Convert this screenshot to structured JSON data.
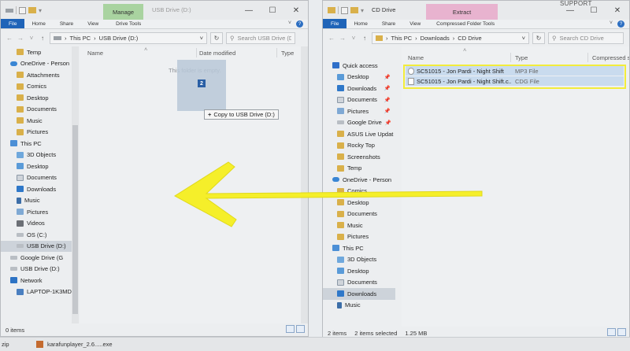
{
  "top_right_label": "SUPPORT",
  "left_window": {
    "context_tab": "Manage",
    "title": "USB Drive (D:)",
    "tabs": [
      "File",
      "Home",
      "Share",
      "View",
      "Drive Tools"
    ],
    "address": [
      "This PC",
      "USB Drive (D:)"
    ],
    "search_placeholder": "Search USB Drive (D:)",
    "columns": [
      "Name",
      "Date modified",
      "Type"
    ],
    "empty_message": "This folder is empty.",
    "nav_items": [
      {
        "label": "Temp",
        "icon": "folder-icon"
      },
      {
        "label": "OneDrive - Person",
        "icon": "onedrive-icon"
      },
      {
        "label": "Attachments",
        "icon": "folder-icon"
      },
      {
        "label": "Comics",
        "icon": "folder-icon"
      },
      {
        "label": "Desktop",
        "icon": "folder-icon"
      },
      {
        "label": "Documents",
        "icon": "folder-icon"
      },
      {
        "label": "Music",
        "icon": "folder-icon"
      },
      {
        "label": "Pictures",
        "icon": "folder-icon"
      },
      {
        "label": "This PC",
        "icon": "this-pc-icon"
      },
      {
        "label": "3D Objects",
        "icon": "3d-objects-icon"
      },
      {
        "label": "Desktop",
        "icon": "desktop-icon"
      },
      {
        "label": "Documents",
        "icon": "documents-icon"
      },
      {
        "label": "Downloads",
        "icon": "downloads-icon"
      },
      {
        "label": "Music",
        "icon": "music-icon"
      },
      {
        "label": "Pictures",
        "icon": "pictures-icon"
      },
      {
        "label": "Videos",
        "icon": "videos-icon"
      },
      {
        "label": "OS (C:)",
        "icon": "drive-icon"
      },
      {
        "label": "USB Drive (D:)",
        "icon": "usb-drive-icon"
      },
      {
        "label": "Google Drive (G",
        "icon": "drive-icon"
      },
      {
        "label": "USB Drive (D:)",
        "icon": "usb-drive-icon"
      },
      {
        "label": "Network",
        "icon": "network-icon"
      },
      {
        "label": "LAPTOP-1K3MD",
        "icon": "laptop-icon"
      }
    ],
    "status_items": "0 items",
    "drag_count": "2",
    "drop_tooltip": "Copy to USB Drive (D:)"
  },
  "right_window": {
    "context_tab": "Extract",
    "title": "CD Drive",
    "tabs": [
      "File",
      "Home",
      "Share",
      "View",
      "Compressed Folder Tools"
    ],
    "address": [
      "This PC",
      "Downloads",
      "CD Drive"
    ],
    "search_placeholder": "Search CD Drive",
    "columns": [
      "Name",
      "Type",
      "Compressed s"
    ],
    "nav_items": [
      {
        "label": "Quick access",
        "icon": "quick-access-icon"
      },
      {
        "label": "Desktop",
        "icon": "desktop-icon",
        "pinned": true
      },
      {
        "label": "Downloads",
        "icon": "downloads-icon",
        "pinned": true
      },
      {
        "label": "Documents",
        "icon": "documents-icon",
        "pinned": true
      },
      {
        "label": "Pictures",
        "icon": "pictures-icon",
        "pinned": true
      },
      {
        "label": "Google Drive",
        "icon": "drive-icon",
        "pinned": true
      },
      {
        "label": "ASUS Live Updat",
        "icon": "folder-icon"
      },
      {
        "label": "Rocky Top",
        "icon": "folder-icon"
      },
      {
        "label": "Screenshots",
        "icon": "folder-icon"
      },
      {
        "label": "Temp",
        "icon": "folder-icon"
      },
      {
        "label": "OneDrive - Person",
        "icon": "onedrive-icon"
      },
      {
        "label": "Comics",
        "icon": "folder-icon"
      },
      {
        "label": "Desktop",
        "icon": "folder-icon"
      },
      {
        "label": "Documents",
        "icon": "folder-icon"
      },
      {
        "label": "Music",
        "icon": "folder-icon"
      },
      {
        "label": "Pictures",
        "icon": "folder-icon"
      },
      {
        "label": "This PC",
        "icon": "this-pc-icon"
      },
      {
        "label": "3D Objects",
        "icon": "3d-objects-icon"
      },
      {
        "label": "Desktop",
        "icon": "desktop-icon"
      },
      {
        "label": "Documents",
        "icon": "documents-icon"
      },
      {
        "label": "Downloads",
        "icon": "downloads-icon"
      },
      {
        "label": "Music",
        "icon": "music-icon"
      }
    ],
    "files": [
      {
        "name": "SC51015 - Jon Pardi - Night Shift",
        "type": "MP3 File",
        "icon": "audio-file-icon"
      },
      {
        "name": "SC51015 - Jon Pardi - Night Shift.c...",
        "type": "CDG File",
        "icon": "file-icon"
      }
    ],
    "status_items": "2 items",
    "status_selected": "2 items selected",
    "status_size": "1.25 MB"
  },
  "taskbar": {
    "items": [
      "zip",
      "karafunplayer_2.6.....exe"
    ]
  },
  "colors": {
    "highlight_border": "#f2ec3b",
    "arrow": "#f5ef2a",
    "file_tab": "#1f64b8",
    "selected_row": "#c9dbee",
    "extract_tab": "#e8b3cf",
    "manage_tab": "#a9d3a0"
  }
}
